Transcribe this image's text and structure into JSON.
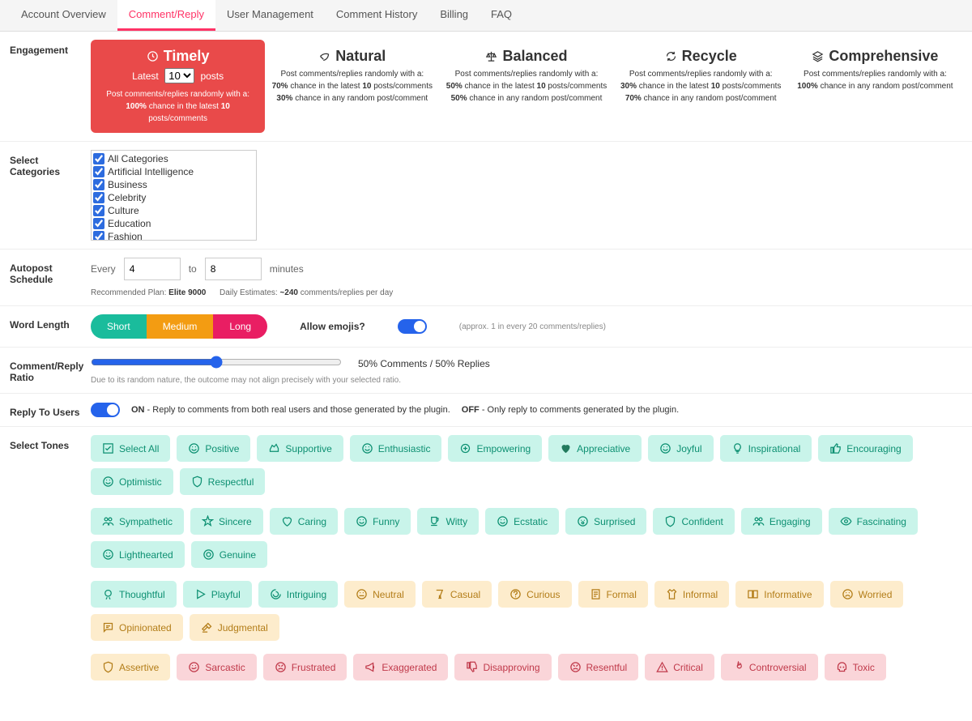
{
  "tabs": [
    "Account Overview",
    "Comment/Reply",
    "User Management",
    "Comment History",
    "Billing",
    "FAQ"
  ],
  "labels": {
    "engagement": "Engagement",
    "selectCategories": "Select Categories",
    "autopost": "Autopost Schedule",
    "wordlen": "Word Length",
    "ratio": "Comment/Reply Ratio",
    "replyUsers": "Reply To Users",
    "tones": "Select Tones"
  },
  "engagement": {
    "cards": [
      {
        "title": "Timely",
        "selected": true,
        "latestPrefix": "Latest",
        "latestValue": "10",
        "latestSuffix": "posts",
        "desc": "Post comments/replies randomly with a:<br><b>100%</b> chance in the latest <b>10</b> posts/comments"
      },
      {
        "title": "Natural",
        "desc": "Post comments/replies randomly with a:<br><b>70%</b> chance in the latest <b>10</b> posts/comments<br><b>30%</b> chance in any random post/comment"
      },
      {
        "title": "Balanced",
        "desc": "Post comments/replies randomly with a:<br><b>50%</b> chance in the latest <b>10</b> posts/comments<br><b>50%</b> chance in any random post/comment"
      },
      {
        "title": "Recycle",
        "desc": "Post comments/replies randomly with a:<br><b>30%</b> chance in the latest <b>10</b> posts/comments<br><b>70%</b> chance in any random post/comment"
      },
      {
        "title": "Comprehensive",
        "desc": "Post comments/replies randomly with a:<br><b>100%</b> chance in any random post/comment"
      }
    ]
  },
  "categories": [
    "All Categories",
    "Artificial Intelligence",
    "Business",
    "Celebrity",
    "Culture",
    "Education",
    "Fashion"
  ],
  "autopost": {
    "every": "Every",
    "from": "4",
    "to": "to",
    "toVal": "8",
    "unit": "minutes",
    "rec": "Recommended Plan: <b>Elite 9000</b>&nbsp;&nbsp;&nbsp;&nbsp;&nbsp;&nbsp;Daily Estimates: <b>~240</b> comments/replies per day"
  },
  "wordlen": {
    "short": "Short",
    "medium": "Medium",
    "long": "Long"
  },
  "emoji": {
    "q": "Allow emojis?",
    "note": "(approx. 1 in every 20 comments/replies)"
  },
  "ratio": {
    "text": "50% Comments / 50% Replies",
    "note": "Due to its random nature, the outcome may not align precisely with your selected ratio.",
    "value": 50
  },
  "reply": {
    "on": "ON",
    "onDesc": " - Reply to comments from both real users and those generated by the plugin.",
    "off": "OFF",
    "offDesc": " - Only reply to comments generated by the plugin."
  },
  "tones": {
    "row1": [
      {
        "label": "Select All",
        "c": "teal",
        "icon": "check"
      },
      {
        "label": "Positive",
        "c": "teal",
        "icon": "smile"
      },
      {
        "label": "Supportive",
        "c": "teal",
        "icon": "hand"
      },
      {
        "label": "Enthusiastic",
        "c": "teal",
        "icon": "smile"
      },
      {
        "label": "Empowering",
        "c": "teal",
        "icon": "fist"
      },
      {
        "label": "Appreciative",
        "c": "teal",
        "icon": "heart"
      },
      {
        "label": "Joyful",
        "c": "teal",
        "icon": "smile"
      },
      {
        "label": "Inspirational",
        "c": "teal",
        "icon": "bulb"
      },
      {
        "label": "Encouraging",
        "c": "teal",
        "icon": "thumb"
      },
      {
        "label": "Optimistic",
        "c": "teal",
        "icon": "smile"
      },
      {
        "label": "Respectful",
        "c": "teal",
        "icon": "shield"
      }
    ],
    "row2": [
      {
        "label": "Sympathetic",
        "c": "teal",
        "icon": "people"
      },
      {
        "label": "Sincere",
        "c": "teal",
        "icon": "star"
      },
      {
        "label": "Caring",
        "c": "teal",
        "icon": "heart2"
      },
      {
        "label": "Funny",
        "c": "teal",
        "icon": "smile"
      },
      {
        "label": "Witty",
        "c": "teal",
        "icon": "cup"
      },
      {
        "label": "Ecstatic",
        "c": "teal",
        "icon": "smile"
      },
      {
        "label": "Surprised",
        "c": "teal",
        "icon": "surprise"
      },
      {
        "label": "Confident",
        "c": "teal",
        "icon": "shield"
      },
      {
        "label": "Engaging",
        "c": "teal",
        "icon": "people"
      },
      {
        "label": "Fascinating",
        "c": "teal",
        "icon": "eye"
      },
      {
        "label": "Lighthearted",
        "c": "teal",
        "icon": "smile"
      },
      {
        "label": "Genuine",
        "c": "teal",
        "icon": "target"
      }
    ],
    "row3": [
      {
        "label": "Thoughtful",
        "c": "teal",
        "icon": "think"
      },
      {
        "label": "Playful",
        "c": "teal",
        "icon": "play"
      },
      {
        "label": "Intriguing",
        "c": "teal",
        "icon": "swirl"
      },
      {
        "label": "Neutral",
        "c": "yellow",
        "icon": "neutral"
      },
      {
        "label": "Casual",
        "c": "yellow",
        "icon": "glass"
      },
      {
        "label": "Curious",
        "c": "yellow",
        "icon": "question"
      },
      {
        "label": "Formal",
        "c": "yellow",
        "icon": "doc"
      },
      {
        "label": "Informal",
        "c": "yellow",
        "icon": "shirt"
      },
      {
        "label": "Informative",
        "c": "yellow",
        "icon": "book"
      },
      {
        "label": "Worried",
        "c": "yellow",
        "icon": "worried"
      },
      {
        "label": "Opinionated",
        "c": "yellow",
        "icon": "chat"
      },
      {
        "label": "Judgmental",
        "c": "yellow",
        "icon": "gavel"
      }
    ],
    "row4": [
      {
        "label": "Assertive",
        "c": "yellow",
        "icon": "shield"
      },
      {
        "label": "Sarcastic",
        "c": "pink",
        "icon": "smirk"
      },
      {
        "label": "Frustrated",
        "c": "pink",
        "icon": "angry"
      },
      {
        "label": "Exaggerated",
        "c": "pink",
        "icon": "mega"
      },
      {
        "label": "Disapproving",
        "c": "pink",
        "icon": "thumbdown"
      },
      {
        "label": "Resentful",
        "c": "pink",
        "icon": "angry"
      },
      {
        "label": "Critical",
        "c": "pink",
        "icon": "warn"
      },
      {
        "label": "Controversial",
        "c": "pink",
        "icon": "fire"
      },
      {
        "label": "Toxic",
        "c": "pink",
        "icon": "skull"
      }
    ]
  }
}
